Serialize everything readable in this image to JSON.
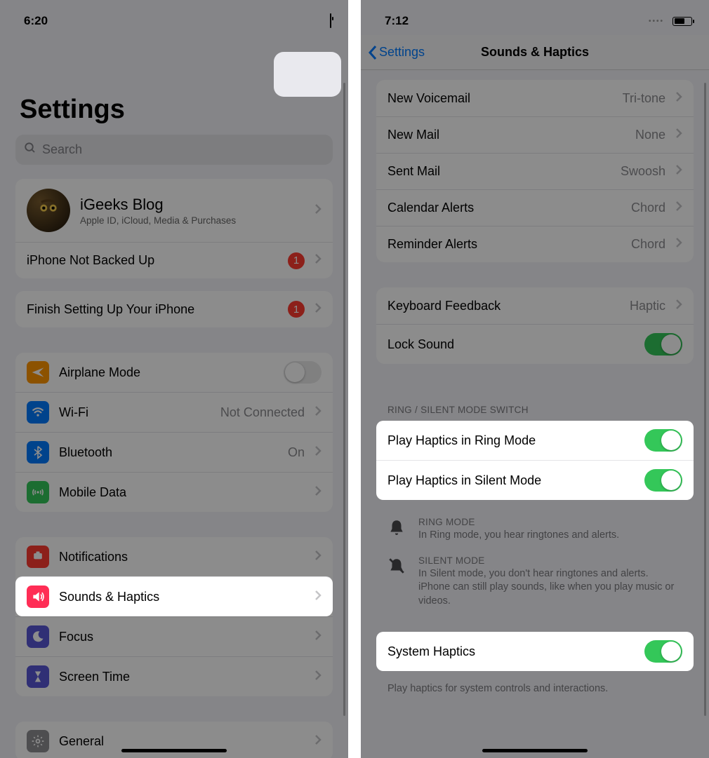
{
  "left": {
    "time": "6:20",
    "title": "Settings",
    "search_placeholder": "Search",
    "profile": {
      "name": "iGeeks Blog",
      "sub": "Apple ID, iCloud, Media & Purchases"
    },
    "backup_row": {
      "label": "iPhone Not Backed Up",
      "badge": "1"
    },
    "finish_row": {
      "label": "Finish Setting Up Your iPhone",
      "badge": "1"
    },
    "net": {
      "airplane": "Airplane Mode",
      "wifi": "Wi-Fi",
      "wifi_val": "Not Connected",
      "bt": "Bluetooth",
      "bt_val": "On",
      "mobile": "Mobile Data"
    },
    "list2": {
      "notifications": "Notifications",
      "sounds": "Sounds & Haptics",
      "focus": "Focus",
      "screentime": "Screen Time"
    },
    "general": "General"
  },
  "right": {
    "time": "7:12",
    "back": "Settings",
    "title": "Sounds & Haptics",
    "alerts": [
      {
        "label": "New Voicemail",
        "value": "Tri-tone"
      },
      {
        "label": "New Mail",
        "value": "None"
      },
      {
        "label": "Sent Mail",
        "value": "Swoosh"
      },
      {
        "label": "Calendar Alerts",
        "value": "Chord"
      },
      {
        "label": "Reminder Alerts",
        "value": "Chord"
      }
    ],
    "kb": {
      "label": "Keyboard Feedback",
      "value": "Haptic"
    },
    "lock": "Lock Sound",
    "ring_header": "Ring / Silent Mode Switch",
    "haptics_ring": "Play Haptics in Ring Mode",
    "haptics_silent": "Play Haptics in Silent Mode",
    "ring_mode_hd": "Ring Mode",
    "ring_mode_desc": "In Ring mode, you hear ringtones and alerts.",
    "silent_mode_hd": "Silent Mode",
    "silent_mode_desc": "In Silent mode, you don't hear ringtones and alerts. iPhone can still play sounds, like when you play music or videos.",
    "system_haptics": "System Haptics",
    "sh_footer": "Play haptics for system controls and interactions."
  }
}
